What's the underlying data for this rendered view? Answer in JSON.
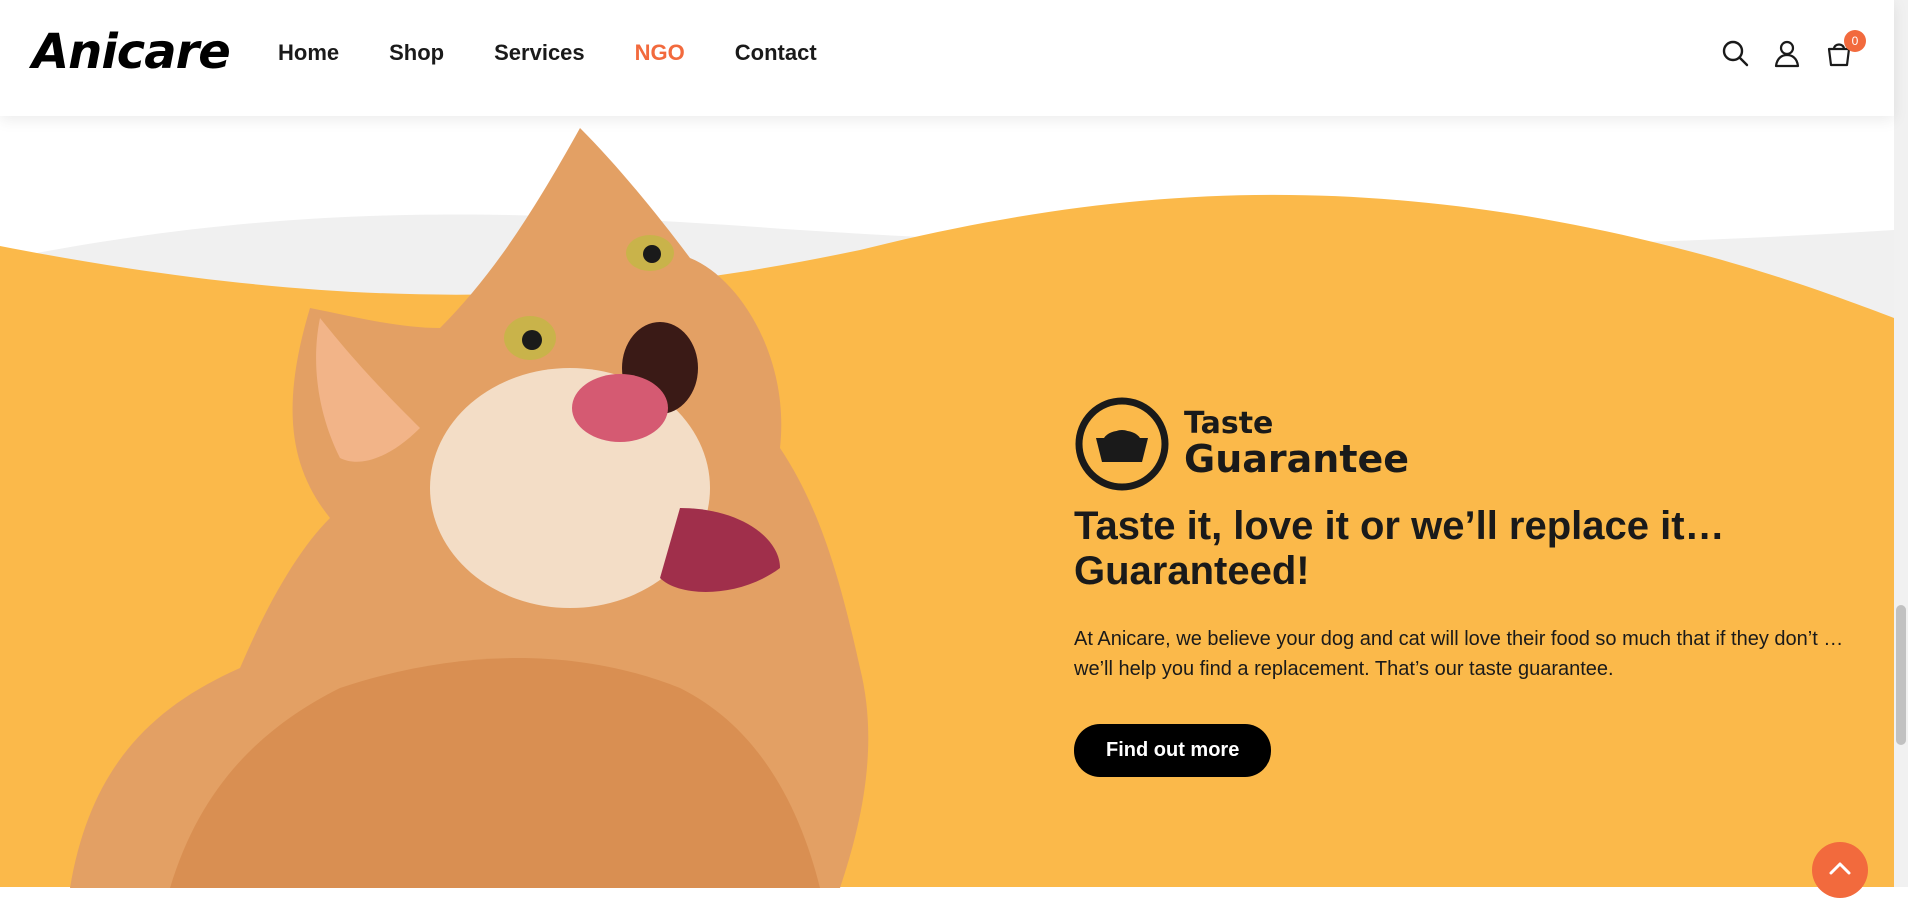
{
  "brand": {
    "logo_text": "Anicare"
  },
  "nav": {
    "items": [
      "Home",
      "Shop",
      "Services",
      "NGO",
      "Contact"
    ],
    "active_index": 3
  },
  "header_icons": [
    "search-icon",
    "user-icon",
    "cart-icon"
  ],
  "cart": {
    "count": "0"
  },
  "hero": {
    "badge_line1": "Taste",
    "badge_line2": "Guarantee",
    "headline": "Taste it, love it or we’ll replace it… Guaranteed!",
    "description": "At Anicare, we believe your dog and cat will love their food so much that if they don’t … we’ll help you find a replacement. That’s our taste guarantee.",
    "cta_label": "Find out more"
  },
  "colors": {
    "accent": "#f26a3d",
    "hero_bg": "#fbb94a",
    "text": "#1a1a1a"
  }
}
